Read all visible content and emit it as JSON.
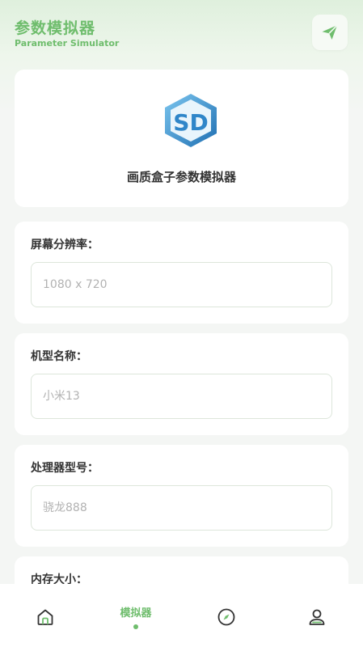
{
  "header": {
    "title": "参数模拟器",
    "subtitle": "Parameter Simulator",
    "send_icon": "send-icon"
  },
  "logo_card": {
    "logo_letters": "SD",
    "caption": "画质盒子参数模拟器"
  },
  "fields": [
    {
      "label": "屏幕分辨率：",
      "placeholder": "1080 x 720",
      "value": ""
    },
    {
      "label": "机型名称：",
      "placeholder": "小米13",
      "value": ""
    },
    {
      "label": "处理器型号：",
      "placeholder": "骁龙888",
      "value": ""
    },
    {
      "label": "内存大小：",
      "placeholder": "",
      "value": ""
    }
  ],
  "bottom_nav": {
    "items": [
      {
        "icon": "home-icon"
      },
      {
        "label": "模拟器",
        "active": true
      },
      {
        "icon": "compass-icon"
      },
      {
        "icon": "user-icon"
      }
    ]
  },
  "colors": {
    "accent": "#6fbd6d",
    "logo_blue": "#2f86c9",
    "text": "#333333",
    "placeholder": "#b2b2b2"
  }
}
